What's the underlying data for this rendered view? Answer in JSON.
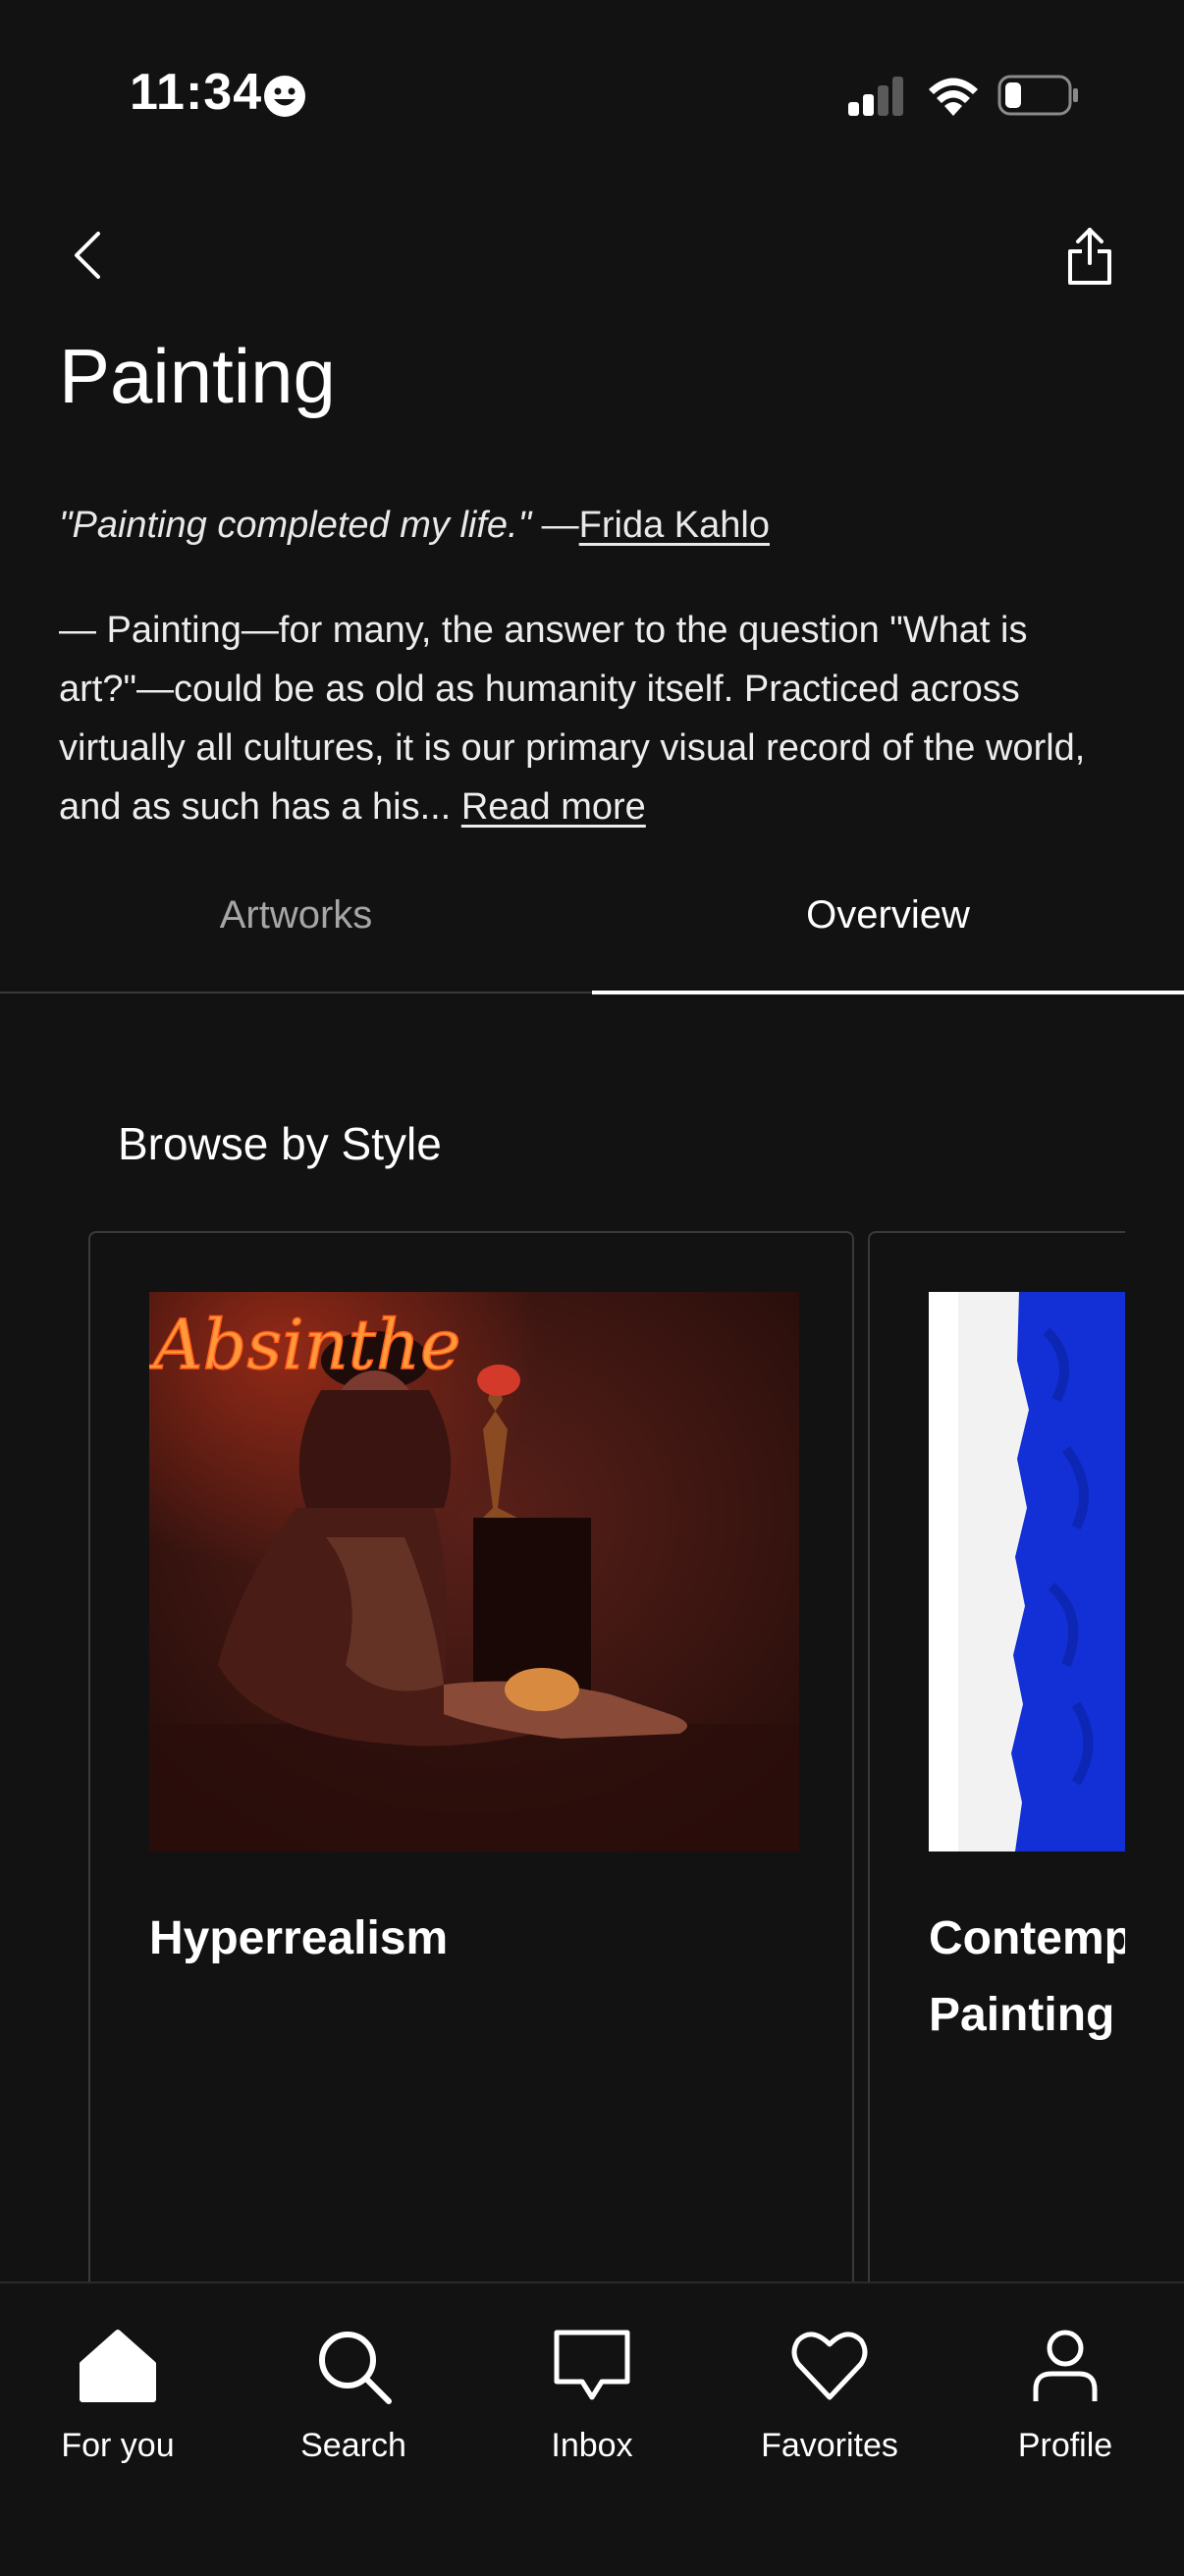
{
  "status_bar": {
    "time": "11:34",
    "emoji_icon": "smiley-face-icon",
    "signal_icon": "cellular-signal-icon",
    "wifi_icon": "wifi-icon",
    "battery_icon": "battery-low-icon"
  },
  "header": {
    "back_icon": "chevron-left-icon",
    "share_icon": "share-icon",
    "title": "Painting"
  },
  "quote": {
    "text": "\"Painting completed my life.\"",
    "separator": " —",
    "author": "Frida Kahlo"
  },
  "description": {
    "text": " — Painting—for many, the answer to the question \"What is art?\"—could be as old as humanity itself. Practiced across virtually all cultures, it is our primary visual record of the world, and as such has a his... ",
    "read_more": "Read more"
  },
  "tabs": [
    {
      "label": "Artworks",
      "active": false
    },
    {
      "label": "Overview",
      "active": true
    }
  ],
  "browse": {
    "title": "Browse by Style",
    "cards": [
      {
        "label": "Hyperrealism",
        "image_text": "Absinthe"
      },
      {
        "label": "Contemp\nPainting"
      }
    ]
  },
  "bottom_nav": [
    {
      "label": "For you",
      "icon": "home-icon",
      "active": true
    },
    {
      "label": "Search",
      "icon": "search-icon",
      "active": false
    },
    {
      "label": "Inbox",
      "icon": "inbox-icon",
      "active": false
    },
    {
      "label": "Favorites",
      "icon": "heart-icon",
      "active": false
    },
    {
      "label": "Profile",
      "icon": "profile-icon",
      "active": false
    }
  ],
  "colors": {
    "background": "#121212",
    "text": "#ffffff",
    "muted_text": "#a6a6a6",
    "divider": "#3a3a3a",
    "klein_blue": "#1230d6"
  }
}
